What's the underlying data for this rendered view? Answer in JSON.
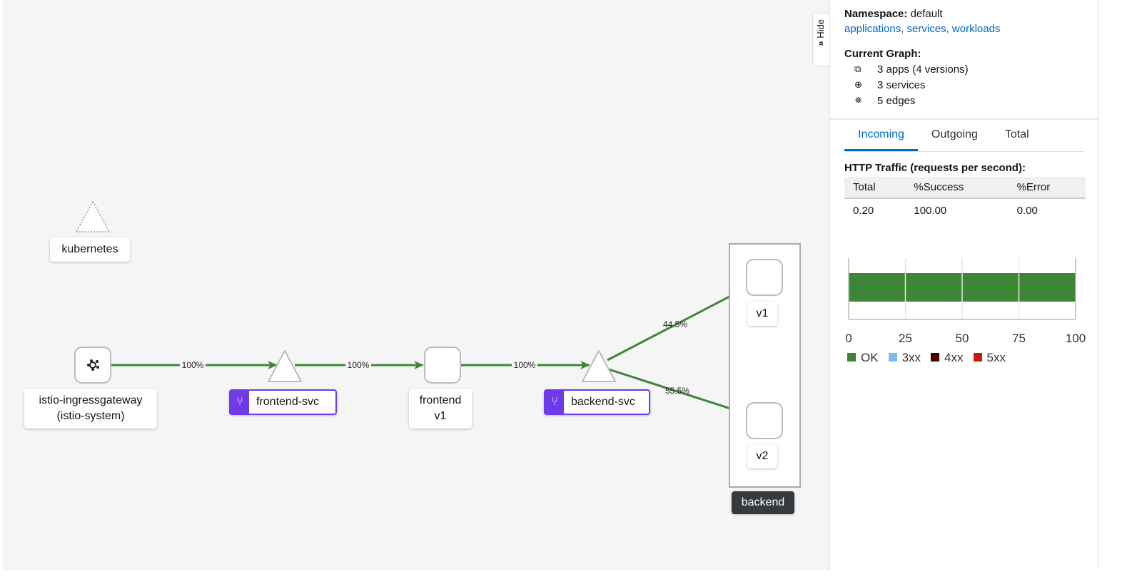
{
  "graph": {
    "nodes": {
      "kubernetes": "kubernetes",
      "gateway_line1": "istio-ingressgateway",
      "gateway_line2": "(istio-system)",
      "frontend_svc": "frontend-svc",
      "frontend_line1": "frontend",
      "frontend_line2": "v1",
      "backend_svc": "backend-svc",
      "v1": "v1",
      "v2": "v2",
      "backend": "backend"
    },
    "edges": {
      "gw_to_fsvc": "100%",
      "fsvc_to_frontend": "100%",
      "frontend_to_bsvc": "100%",
      "bsvc_to_v1": "44.5%",
      "bsvc_to_v2": "55.5%"
    },
    "edge_color": "#3e8635"
  },
  "hide_label": "Hide",
  "side": {
    "namespace_label": "Namespace:",
    "namespace": "default",
    "links": "applications, services, workloads",
    "current_graph": "Current Graph:",
    "apps": "3 apps (4 versions)",
    "services": "3 services",
    "edges": "5 edges",
    "tabs": [
      "Incoming",
      "Outgoing",
      "Total"
    ],
    "http_title": "HTTP Traffic (requests per second):",
    "table": {
      "headers": [
        "Total",
        "%Success",
        "%Error"
      ],
      "row": [
        "0.20",
        "100.00",
        "0.00"
      ]
    }
  },
  "chart_data": {
    "type": "bar",
    "orientation": "horizontal",
    "stacked": true,
    "xlim": [
      0,
      100
    ],
    "ticks": [
      "0",
      "25",
      "50",
      "75",
      "100"
    ],
    "series": [
      {
        "name": "OK",
        "value": 100,
        "color": "#3e8635"
      },
      {
        "name": "3xx",
        "value": 0,
        "color": "#73bcf7"
      },
      {
        "name": "4xx",
        "value": 0,
        "color": "#470000"
      },
      {
        "name": "5xx",
        "value": 0,
        "color": "#c9190b"
      }
    ],
    "legend": "bottom"
  }
}
